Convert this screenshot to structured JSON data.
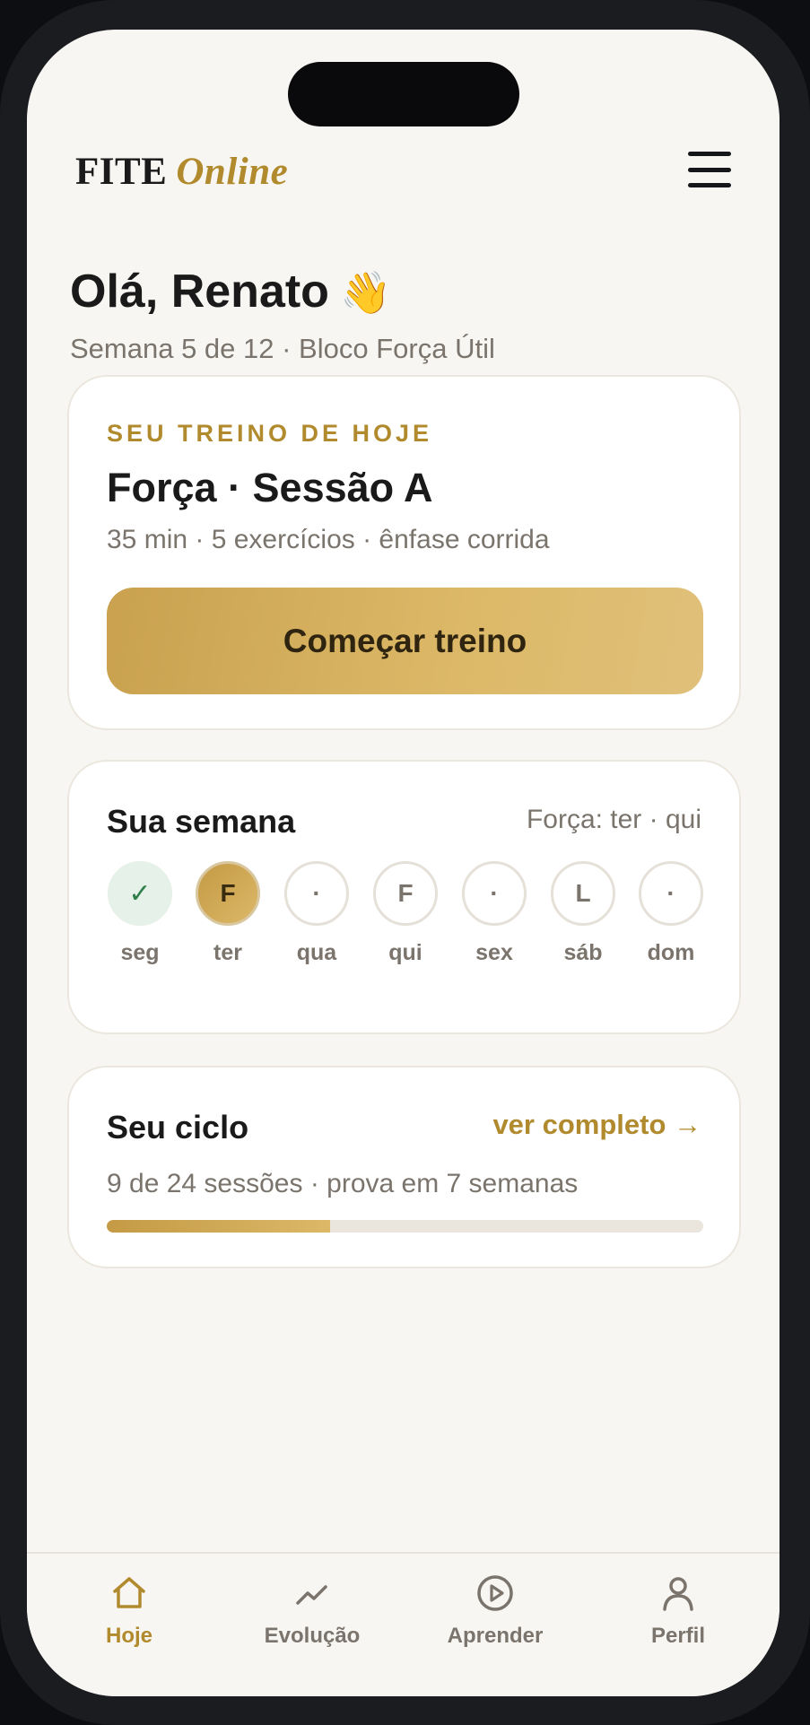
{
  "header": {
    "logo_primary": "FITE",
    "logo_secondary": "Online",
    "menu_icon": "hamburger-menu-icon"
  },
  "greeting": {
    "title": "Olá, Renato",
    "emoji": "👋",
    "subtitle": "Semana 5 de 12 · Bloco Força Útil"
  },
  "today_card": {
    "eyebrow": "SEU TREINO DE HOJE",
    "title": "Força · Sessão A",
    "meta": "35 min · 5 exercícios · ênfase corrida",
    "button_label": "Começar treino"
  },
  "week_card": {
    "title": "Sua semana",
    "note": "Força: ter · qui",
    "days": [
      {
        "label": "seg",
        "mark": "✓",
        "state": "done"
      },
      {
        "label": "ter",
        "mark": "F",
        "state": "today"
      },
      {
        "label": "qua",
        "mark": "·",
        "state": "rest"
      },
      {
        "label": "qui",
        "mark": "F",
        "state": "planned"
      },
      {
        "label": "sex",
        "mark": "·",
        "state": "rest"
      },
      {
        "label": "sáb",
        "mark": "L",
        "state": "planned"
      },
      {
        "label": "dom",
        "mark": "·",
        "state": "rest"
      }
    ]
  },
  "cycle_card": {
    "title": "Seu ciclo",
    "link_label": "ver completo →",
    "meta": "9 de 24 sessões · prova em 7 semanas",
    "progress_fraction": 0.375
  },
  "tabbar": {
    "tabs": [
      {
        "label": "Hoje",
        "icon": "home-icon",
        "active": true
      },
      {
        "label": "Evolução",
        "icon": "trend-chart-icon",
        "active": false
      },
      {
        "label": "Aprender",
        "icon": "play-circle-icon",
        "active": false
      },
      {
        "label": "Perfil",
        "icon": "user-icon",
        "active": false
      }
    ]
  },
  "colors": {
    "accent": "#b08a2c",
    "background": "#f8f6f2",
    "card": "#ffffff",
    "text": "#1a1a1a",
    "muted": "#7a746c",
    "done": "#2f7d4a"
  }
}
